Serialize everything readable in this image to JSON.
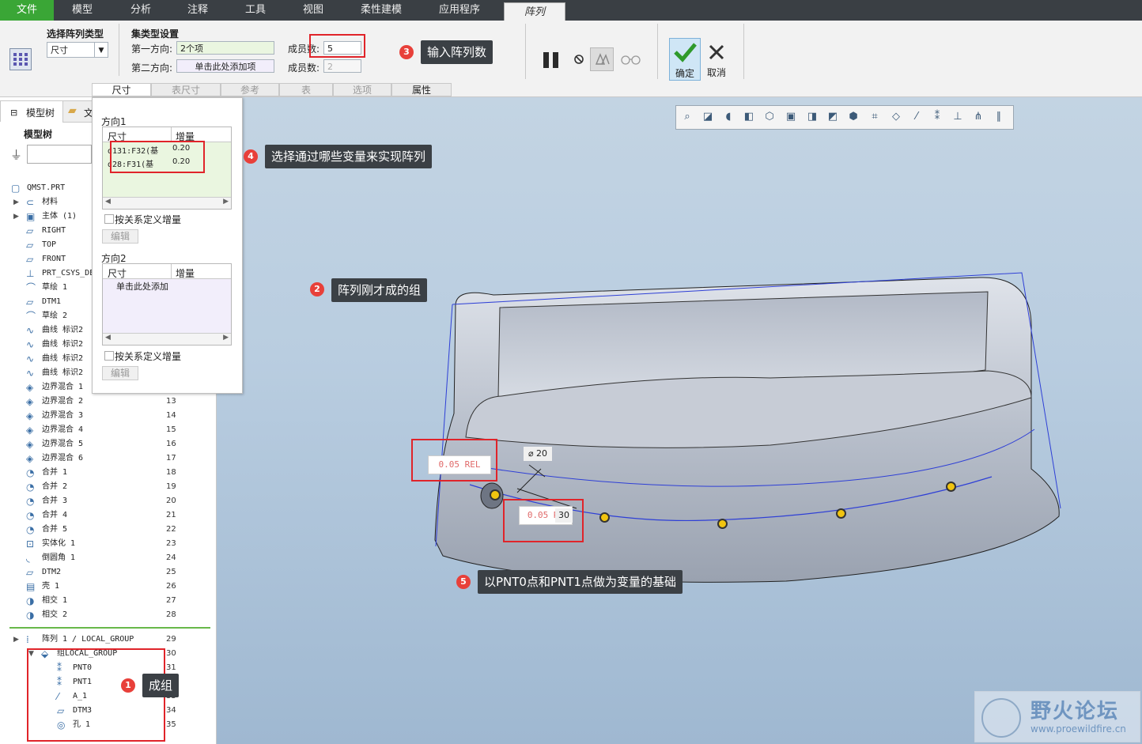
{
  "menu": {
    "tabs": [
      "文件",
      "模型",
      "分析",
      "注释",
      "工具",
      "视图",
      "柔性建模",
      "应用程序",
      "阵列"
    ],
    "active_tab": "阵列"
  },
  "ribbon": {
    "pattern_type_title": "选择阵列类型",
    "pattern_type_value": "尺寸",
    "set_type_title": "集类型设置",
    "dir1_label": "第一方向:",
    "dir1_value": "2个项",
    "dir2_label": "第二方向:",
    "dir2_value": "单击此处添加项",
    "members_label_1": "成员数:",
    "members_value_1": "5",
    "members_label_2": "成员数:",
    "members_value_2": "2",
    "ok_label": "确定",
    "cancel_label": "取消",
    "subtabs": [
      "尺寸",
      "表尺寸",
      "参考",
      "表",
      "选项",
      "属性"
    ]
  },
  "left_tabs": {
    "model_tree": "模型树",
    "second": "文"
  },
  "tree": {
    "title": "模型树",
    "items": [
      {
        "label": "QMST.PRT",
        "icon": "part-icon",
        "num": ""
      },
      {
        "label": "材料",
        "icon": "material-icon",
        "num": ""
      },
      {
        "label": "主体 (1)",
        "icon": "body-icon",
        "num": ""
      },
      {
        "label": "RIGHT",
        "icon": "datum-plane-icon",
        "num": ""
      },
      {
        "label": "TOP",
        "icon": "datum-plane-icon",
        "num": ""
      },
      {
        "label": "FRONT",
        "icon": "datum-plane-icon",
        "num": ""
      },
      {
        "label": "PRT_CSYS_DE",
        "icon": "csys-icon",
        "num": ""
      },
      {
        "label": "草绘 1",
        "icon": "sketch-icon",
        "num": ""
      },
      {
        "label": "DTM1",
        "icon": "datum-plane-icon",
        "num": ""
      },
      {
        "label": "草绘 2",
        "icon": "sketch-icon",
        "num": ""
      },
      {
        "label": "曲线 标识2",
        "icon": "curve-icon",
        "num": ""
      },
      {
        "label": "曲线 标识2",
        "icon": "curve-icon",
        "num": ""
      },
      {
        "label": "曲线 标识2",
        "icon": "curve-icon",
        "num": ""
      },
      {
        "label": "曲线 标识2",
        "icon": "curve-icon",
        "num": ""
      },
      {
        "label": "边界混合 1",
        "icon": "blend-icon",
        "num": ""
      },
      {
        "label": "边界混合 2",
        "icon": "blend-icon",
        "num": "13"
      },
      {
        "label": "边界混合 3",
        "icon": "blend-icon",
        "num": "14"
      },
      {
        "label": "边界混合 4",
        "icon": "blend-icon",
        "num": "15"
      },
      {
        "label": "边界混合 5",
        "icon": "blend-icon",
        "num": "16"
      },
      {
        "label": "边界混合 6",
        "icon": "blend-icon",
        "num": "17"
      },
      {
        "label": "合并 1",
        "icon": "merge-icon",
        "num": "18"
      },
      {
        "label": "合并 2",
        "icon": "merge-icon",
        "num": "19"
      },
      {
        "label": "合并 3",
        "icon": "merge-icon",
        "num": "20"
      },
      {
        "label": "合并 4",
        "icon": "merge-icon",
        "num": "21"
      },
      {
        "label": "合并 5",
        "icon": "merge-icon",
        "num": "22"
      },
      {
        "label": "实体化 1",
        "icon": "solidify-icon",
        "num": "23"
      },
      {
        "label": "倒圆角 1",
        "icon": "round-icon",
        "num": "24"
      },
      {
        "label": "DTM2",
        "icon": "datum-plane-icon",
        "num": "25"
      },
      {
        "label": "壳 1",
        "icon": "shell-icon",
        "num": "26"
      },
      {
        "label": "相交 1",
        "icon": "intersect-icon",
        "num": "27"
      },
      {
        "label": "相交 2",
        "icon": "intersect-icon",
        "num": "28"
      }
    ],
    "pattern_items": [
      {
        "label": "阵列 1 / LOCAL_GROUP",
        "icon": "pattern-icon",
        "num": "29"
      },
      {
        "label": "组LOCAL_GROUP",
        "icon": "group-icon",
        "num": "30"
      },
      {
        "label": "PNT0",
        "icon": "datum-point-icon",
        "num": "31"
      },
      {
        "label": "PNT1",
        "icon": "datum-point-icon",
        "num": "32"
      },
      {
        "label": "A_1",
        "icon": "axis-icon",
        "num": "33"
      },
      {
        "label": "DTM3",
        "icon": "datum-plane-icon",
        "num": "34"
      },
      {
        "label": "孔 1",
        "icon": "hole-icon",
        "num": "35"
      }
    ]
  },
  "popup": {
    "dir1_title": "方向1",
    "col_dim": "尺寸",
    "col_inc": "增量",
    "rows": [
      {
        "dim": "d131:F32(基",
        "inc": "0.20"
      },
      {
        "dim": "d28:F31(基",
        "inc": "0.20"
      }
    ],
    "rel_checkbox": "按关系定义增量",
    "edit_button": "编辑",
    "dir2_title": "方向2",
    "dir2_col_dim": "尺寸",
    "dir2_col_inc": "增量",
    "dir2_placeholder": "单击此处添加",
    "rel_checkbox2": "按关系定义增量",
    "edit_button2": "编辑"
  },
  "callouts": [
    {
      "num": "1",
      "text": "成组"
    },
    {
      "num": "2",
      "text": "阵列刚才成的组"
    },
    {
      "num": "3",
      "text": "输入阵列数"
    },
    {
      "num": "4",
      "text": "选择通过哪些变量来实现阵列"
    },
    {
      "num": "5",
      "text": "以PNT0点和PNT1点做为变量的基础"
    }
  ],
  "annotations": {
    "rel1": "0.05 REL",
    "rel2": "0.05 RE",
    "dia": "⌀ 20",
    "dim30": "30"
  },
  "watermark": {
    "title": "野火论坛",
    "url": "www.proewildfire.cn"
  },
  "colors": {
    "menu_bg": "#3a3f44",
    "file_tab": "#3aa636",
    "callout_bg": "#3b4045",
    "badge": "#e8403a",
    "highlight": "#e0242a",
    "edge": "#2e3fd6"
  }
}
